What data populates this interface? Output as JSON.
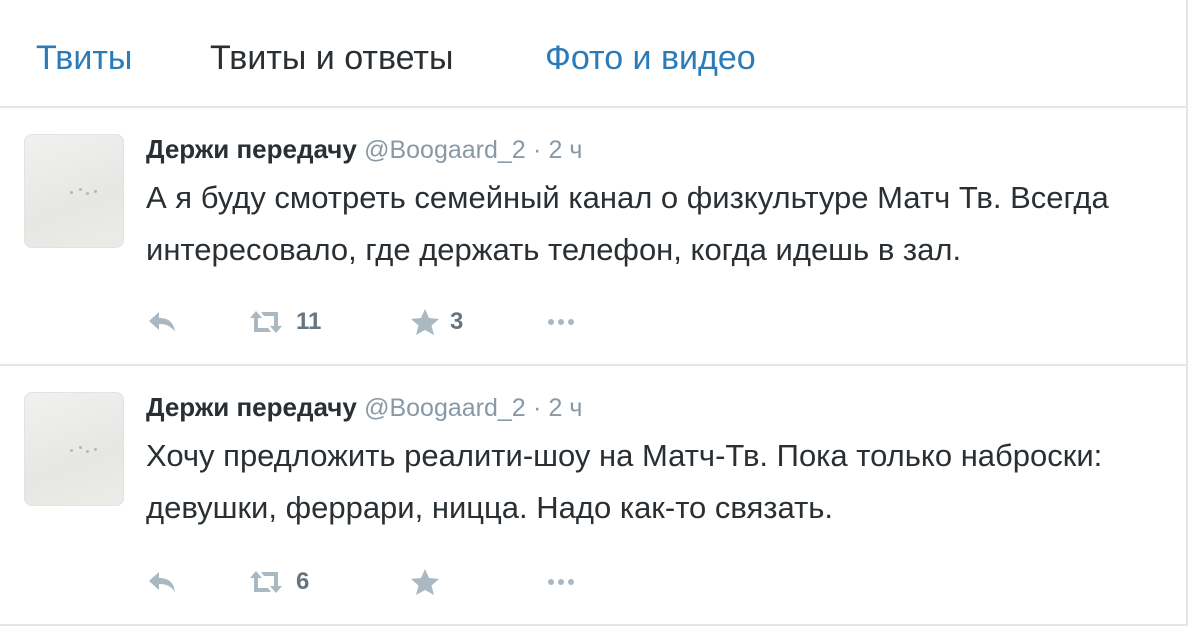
{
  "tabs": [
    {
      "label": "Твиты",
      "color": "#2b7bb9"
    },
    {
      "label": "Твиты и ответы",
      "color": "#292f33"
    },
    {
      "label": "Фото и видео",
      "color": "#2b7bb9"
    }
  ],
  "tweets": [
    {
      "author_name": "Держи передачу",
      "author_handle": "@Boogaard_2",
      "separator": "·",
      "time": "2 ч",
      "text": "А я буду смотреть семейный канал о физкультуре Матч Тв. Всегда интересовало, где держать телефон, когда идешь в зал.",
      "retweets": "11",
      "likes": "3"
    },
    {
      "author_name": "Держи передачу",
      "author_handle": "@Boogaard_2",
      "separator": "·",
      "time": "2 ч",
      "text": "Хочу предложить реалити-шоу на Матч-Тв. Пока только наброски: девушки, феррари, ницца. Надо как-то связать.",
      "retweets": "6",
      "likes": ""
    }
  ],
  "icons": {
    "reply": "reply-icon",
    "retweet": "retweet-icon",
    "favorite": "star-icon",
    "more": "more-icon"
  },
  "colors": {
    "accent": "#2b7bb9",
    "text": "#292f33",
    "muted": "#8899a6",
    "icon": "#aab8c2",
    "border": "#e1e8ed"
  }
}
